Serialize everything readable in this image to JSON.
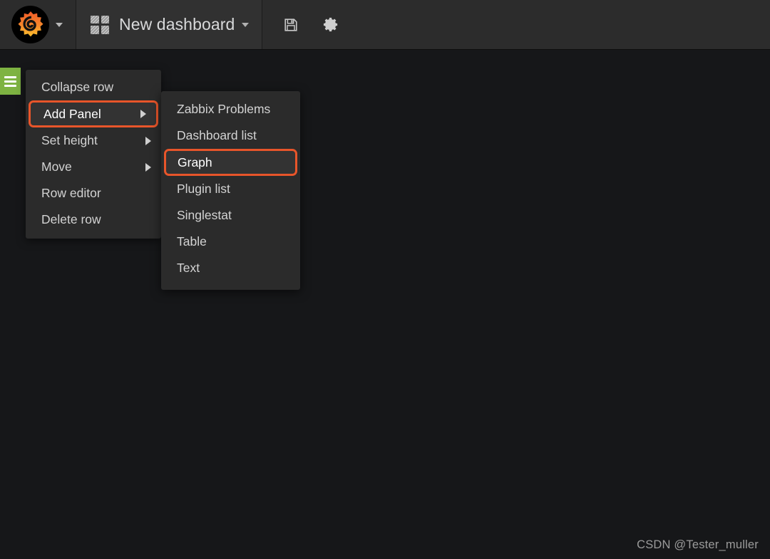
{
  "navbar": {
    "logo_icon": "grafana-logo-icon",
    "logo_caret_icon": "chevron-down-icon",
    "dashboard_icon": "dashboard-grid-icon",
    "dashboard_title": "New dashboard",
    "title_caret_icon": "chevron-down-icon",
    "save_icon": "save-floppy-icon",
    "settings_icon": "gear-icon"
  },
  "row_handle": {
    "icon": "hamburger-menu-icon"
  },
  "row_menu": {
    "items": [
      {
        "label": "Collapse row",
        "has_submenu": false,
        "highlighted": false
      },
      {
        "label": "Add Panel",
        "has_submenu": true,
        "highlighted": true
      },
      {
        "label": "Set height",
        "has_submenu": true,
        "highlighted": false
      },
      {
        "label": "Move",
        "has_submenu": true,
        "highlighted": false
      },
      {
        "label": "Row editor",
        "has_submenu": false,
        "highlighted": false
      },
      {
        "label": "Delete row",
        "has_submenu": false,
        "highlighted": false
      }
    ]
  },
  "panel_submenu": {
    "items": [
      {
        "label": "Zabbix Problems",
        "highlighted": false
      },
      {
        "label": "Dashboard list",
        "highlighted": false
      },
      {
        "label": "Graph",
        "highlighted": true
      },
      {
        "label": "Plugin list",
        "highlighted": false
      },
      {
        "label": "Singlestat",
        "highlighted": false
      },
      {
        "label": "Table",
        "highlighted": false
      },
      {
        "label": "Text",
        "highlighted": false
      }
    ]
  },
  "watermark": {
    "text": "CSDN @Tester_muller"
  },
  "colors": {
    "accent_highlight": "#e8552a",
    "row_handle_green": "#7eb342",
    "navbar_bg": "#2c2c2c",
    "menu_bg": "#2b2b2b",
    "body_bg": "#161719"
  }
}
